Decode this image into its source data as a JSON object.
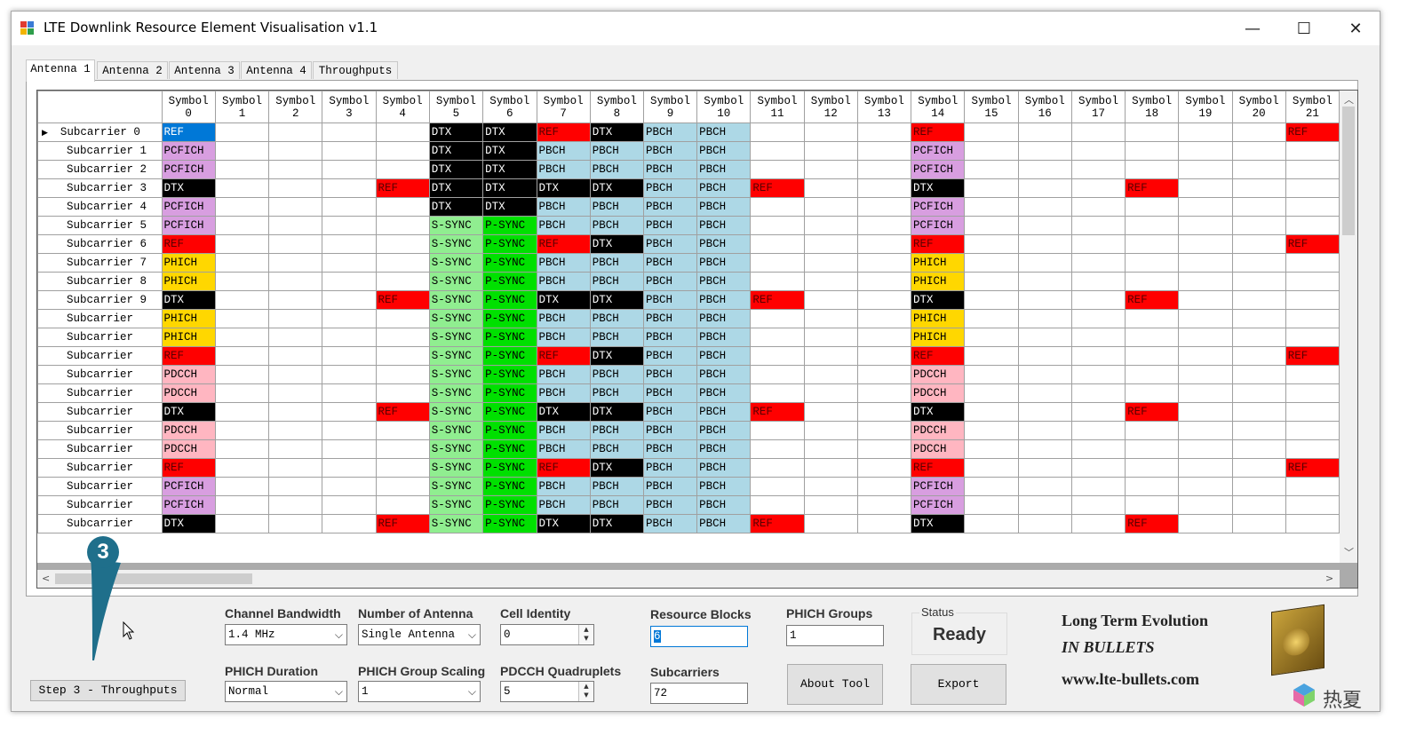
{
  "window": {
    "title": "LTE Downlink Resource Element Visualisation v1.1",
    "minimize": "—",
    "maximize": "☐",
    "close": "✕"
  },
  "tabs": [
    "Antenna 1",
    "Antenna 2",
    "Antenna 3",
    "Antenna 4",
    "Throughputs"
  ],
  "grid": {
    "symbols": [
      "0",
      "1",
      "2",
      "3",
      "4",
      "5",
      "6",
      "7",
      "8",
      "9",
      "10",
      "11",
      "12",
      "13",
      "14",
      "15",
      "16",
      "17",
      "18",
      "19",
      "20",
      "21"
    ],
    "symbol_label": "Symbol",
    "rows": [
      {
        "label": "Subcarrier 0",
        "cells": [
          "REF",
          "",
          "",
          "",
          "",
          "DTX",
          "DTX",
          "REF",
          "DTX",
          "PBCH",
          "PBCH",
          "",
          "",
          "",
          "REF",
          "",
          "",
          "",
          "",
          "",
          "",
          "REF"
        ]
      },
      {
        "label": "Subcarrier 1",
        "cells": [
          "PCFICH",
          "",
          "",
          "",
          "",
          "DTX",
          "DTX",
          "PBCH",
          "PBCH",
          "PBCH",
          "PBCH",
          "",
          "",
          "",
          "PCFICH",
          "",
          "",
          "",
          "",
          "",
          "",
          ""
        ]
      },
      {
        "label": "Subcarrier 2",
        "cells": [
          "PCFICH",
          "",
          "",
          "",
          "",
          "DTX",
          "DTX",
          "PBCH",
          "PBCH",
          "PBCH",
          "PBCH",
          "",
          "",
          "",
          "PCFICH",
          "",
          "",
          "",
          "",
          "",
          "",
          ""
        ]
      },
      {
        "label": "Subcarrier 3",
        "cells": [
          "DTX",
          "",
          "",
          "",
          "REF",
          "DTX",
          "DTX",
          "DTX",
          "DTX",
          "PBCH",
          "PBCH",
          "REF",
          "",
          "",
          "DTX",
          "",
          "",
          "",
          "REF",
          "",
          "",
          ""
        ]
      },
      {
        "label": "Subcarrier 4",
        "cells": [
          "PCFICH",
          "",
          "",
          "",
          "",
          "DTX",
          "DTX",
          "PBCH",
          "PBCH",
          "PBCH",
          "PBCH",
          "",
          "",
          "",
          "PCFICH",
          "",
          "",
          "",
          "",
          "",
          "",
          ""
        ]
      },
      {
        "label": "Subcarrier 5",
        "cells": [
          "PCFICH",
          "",
          "",
          "",
          "",
          "S-SYNC",
          "P-SYNC",
          "PBCH",
          "PBCH",
          "PBCH",
          "PBCH",
          "",
          "",
          "",
          "PCFICH",
          "",
          "",
          "",
          "",
          "",
          "",
          ""
        ]
      },
      {
        "label": "Subcarrier 6",
        "cells": [
          "REF",
          "",
          "",
          "",
          "",
          "S-SYNC",
          "P-SYNC",
          "REF",
          "DTX",
          "PBCH",
          "PBCH",
          "",
          "",
          "",
          "REF",
          "",
          "",
          "",
          "",
          "",
          "",
          "REF"
        ]
      },
      {
        "label": "Subcarrier 7",
        "cells": [
          "PHICH",
          "",
          "",
          "",
          "",
          "S-SYNC",
          "P-SYNC",
          "PBCH",
          "PBCH",
          "PBCH",
          "PBCH",
          "",
          "",
          "",
          "PHICH",
          "",
          "",
          "",
          "",
          "",
          "",
          ""
        ]
      },
      {
        "label": "Subcarrier 8",
        "cells": [
          "PHICH",
          "",
          "",
          "",
          "",
          "S-SYNC",
          "P-SYNC",
          "PBCH",
          "PBCH",
          "PBCH",
          "PBCH",
          "",
          "",
          "",
          "PHICH",
          "",
          "",
          "",
          "",
          "",
          "",
          ""
        ]
      },
      {
        "label": "Subcarrier 9",
        "cells": [
          "DTX",
          "",
          "",
          "",
          "REF",
          "S-SYNC",
          "P-SYNC",
          "DTX",
          "DTX",
          "PBCH",
          "PBCH",
          "REF",
          "",
          "",
          "DTX",
          "",
          "",
          "",
          "REF",
          "",
          "",
          ""
        ]
      },
      {
        "label": "Subcarrier",
        "cells": [
          "PHICH",
          "",
          "",
          "",
          "",
          "S-SYNC",
          "P-SYNC",
          "PBCH",
          "PBCH",
          "PBCH",
          "PBCH",
          "",
          "",
          "",
          "PHICH",
          "",
          "",
          "",
          "",
          "",
          "",
          ""
        ]
      },
      {
        "label": "Subcarrier",
        "cells": [
          "PHICH",
          "",
          "",
          "",
          "",
          "S-SYNC",
          "P-SYNC",
          "PBCH",
          "PBCH",
          "PBCH",
          "PBCH",
          "",
          "",
          "",
          "PHICH",
          "",
          "",
          "",
          "",
          "",
          "",
          ""
        ]
      },
      {
        "label": "Subcarrier",
        "cells": [
          "REF",
          "",
          "",
          "",
          "",
          "S-SYNC",
          "P-SYNC",
          "REF",
          "DTX",
          "PBCH",
          "PBCH",
          "",
          "",
          "",
          "REF",
          "",
          "",
          "",
          "",
          "",
          "",
          "REF"
        ]
      },
      {
        "label": "Subcarrier",
        "cells": [
          "PDCCH",
          "",
          "",
          "",
          "",
          "S-SYNC",
          "P-SYNC",
          "PBCH",
          "PBCH",
          "PBCH",
          "PBCH",
          "",
          "",
          "",
          "PDCCH",
          "",
          "",
          "",
          "",
          "",
          "",
          ""
        ]
      },
      {
        "label": "Subcarrier",
        "cells": [
          "PDCCH",
          "",
          "",
          "",
          "",
          "S-SYNC",
          "P-SYNC",
          "PBCH",
          "PBCH",
          "PBCH",
          "PBCH",
          "",
          "",
          "",
          "PDCCH",
          "",
          "",
          "",
          "",
          "",
          "",
          ""
        ]
      },
      {
        "label": "Subcarrier",
        "cells": [
          "DTX",
          "",
          "",
          "",
          "REF",
          "S-SYNC",
          "P-SYNC",
          "DTX",
          "DTX",
          "PBCH",
          "PBCH",
          "REF",
          "",
          "",
          "DTX",
          "",
          "",
          "",
          "REF",
          "",
          "",
          ""
        ]
      },
      {
        "label": "Subcarrier",
        "cells": [
          "PDCCH",
          "",
          "",
          "",
          "",
          "S-SYNC",
          "P-SYNC",
          "PBCH",
          "PBCH",
          "PBCH",
          "PBCH",
          "",
          "",
          "",
          "PDCCH",
          "",
          "",
          "",
          "",
          "",
          "",
          ""
        ]
      },
      {
        "label": "Subcarrier",
        "cells": [
          "PDCCH",
          "",
          "",
          "",
          "",
          "S-SYNC",
          "P-SYNC",
          "PBCH",
          "PBCH",
          "PBCH",
          "PBCH",
          "",
          "",
          "",
          "PDCCH",
          "",
          "",
          "",
          "",
          "",
          "",
          ""
        ]
      },
      {
        "label": "Subcarrier",
        "cells": [
          "REF",
          "",
          "",
          "",
          "",
          "S-SYNC",
          "P-SYNC",
          "REF",
          "DTX",
          "PBCH",
          "PBCH",
          "",
          "",
          "",
          "REF",
          "",
          "",
          "",
          "",
          "",
          "",
          "REF"
        ]
      },
      {
        "label": "Subcarrier",
        "cells": [
          "PCFICH",
          "",
          "",
          "",
          "",
          "S-SYNC",
          "P-SYNC",
          "PBCH",
          "PBCH",
          "PBCH",
          "PBCH",
          "",
          "",
          "",
          "PCFICH",
          "",
          "",
          "",
          "",
          "",
          "",
          ""
        ]
      },
      {
        "label": "Subcarrier",
        "cells": [
          "PCFICH",
          "",
          "",
          "",
          "",
          "S-SYNC",
          "P-SYNC",
          "PBCH",
          "PBCH",
          "PBCH",
          "PBCH",
          "",
          "",
          "",
          "PCFICH",
          "",
          "",
          "",
          "",
          "",
          "",
          ""
        ]
      },
      {
        "label": "Subcarrier",
        "cells": [
          "DTX",
          "",
          "",
          "",
          "REF",
          "S-SYNC",
          "P-SYNC",
          "DTX",
          "DTX",
          "PBCH",
          "PBCH",
          "REF",
          "",
          "",
          "DTX",
          "",
          "",
          "",
          "REF",
          "",
          "",
          ""
        ]
      }
    ]
  },
  "controls": {
    "channel_bandwidth": {
      "label": "Channel Bandwidth",
      "value": "1.4 MHz"
    },
    "number_of_antenna": {
      "label": "Number of Antenna",
      "value": "Single Antenna"
    },
    "cell_identity": {
      "label": "Cell Identity",
      "value": "0"
    },
    "resource_blocks": {
      "label": "Resource Blocks",
      "value": "6"
    },
    "phich_groups": {
      "label": "PHICH Groups",
      "value": "1"
    },
    "phich_duration": {
      "label": "PHICH Duration",
      "value": "Normal"
    },
    "phich_group_scaling": {
      "label": "PHICH Group Scaling",
      "value": "1"
    },
    "pdcch_quadruplets": {
      "label": "PDCCH Quadruplets",
      "value": "5"
    },
    "subcarriers": {
      "label": "Subcarriers",
      "value": "72"
    },
    "status": {
      "label": "Status",
      "value": "Ready"
    },
    "about_button": "About Tool",
    "export_button": "Export",
    "step_button": "Step 3 - Throughputs"
  },
  "brand": {
    "line1": "Long Term Evolution",
    "line2": "IN BULLETS",
    "line3": "www.lte-bullets.com"
  },
  "callout": {
    "number": "3"
  },
  "watermark": {
    "text": "热夏"
  },
  "colors": {
    "REF": "#ff0000",
    "REF_selected": "#0078d7",
    "DTX": "#000000",
    "PCFICH": "#d89ee0",
    "PHICH": "#ffd700",
    "PDCCH": "#ffb6c1",
    "PBCH": "#add8e6",
    "S-SYNC": "#90ee90",
    "P-SYNC": "#00e000",
    "callout": "#1f6f8b"
  }
}
